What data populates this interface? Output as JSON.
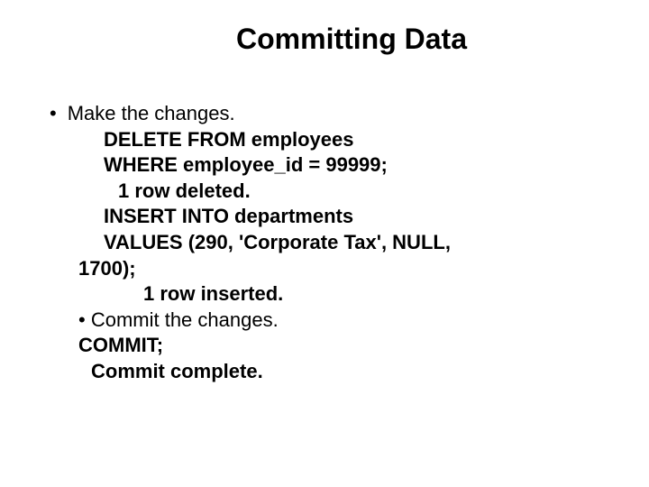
{
  "title": "Committing Data",
  "bullet1": "Make the changes.",
  "line1": "DELETE FROM employees",
  "line2": "WHERE  employee_id = 99999;",
  "line3": "1 row deleted.",
  "line4": "INSERT INTO departments",
  "line5": "VALUES (290, 'Corporate Tax', NULL,",
  "line6": "1700);",
  "line7": "1 row inserted.",
  "bullet2": "• Commit the changes.",
  "line8": "COMMIT;",
  "line9": "Commit complete."
}
